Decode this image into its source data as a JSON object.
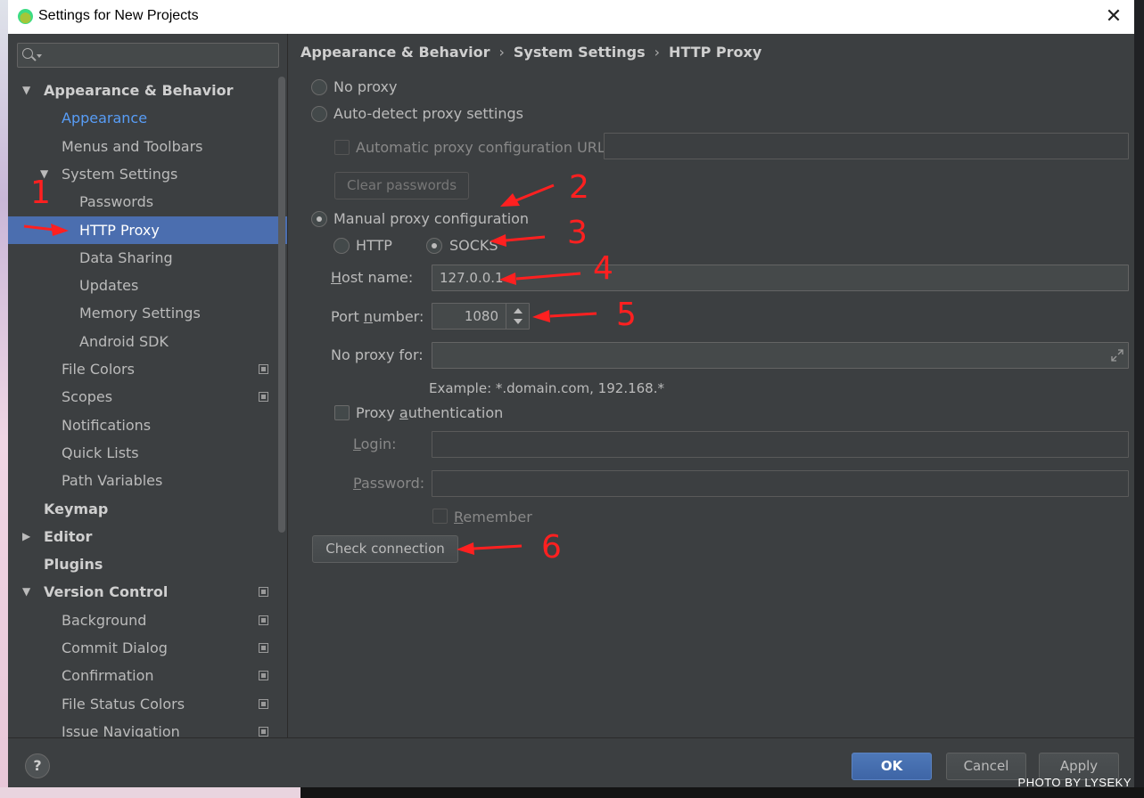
{
  "window": {
    "title": "Settings for New Projects",
    "close_glyph": "✕"
  },
  "search": {
    "placeholder": ""
  },
  "tree": [
    {
      "label": "Appearance & Behavior",
      "level": 0,
      "bold": true,
      "expanded": true
    },
    {
      "label": "Appearance",
      "level": 1,
      "link": true
    },
    {
      "label": "Menus and Toolbars",
      "level": 1
    },
    {
      "label": "System Settings",
      "level": 1,
      "expanded": true
    },
    {
      "label": "Passwords",
      "level": 2
    },
    {
      "label": "HTTP Proxy",
      "level": 2,
      "selected": true
    },
    {
      "label": "Data Sharing",
      "level": 2
    },
    {
      "label": "Updates",
      "level": 2
    },
    {
      "label": "Memory Settings",
      "level": 2
    },
    {
      "label": "Android SDK",
      "level": 2
    },
    {
      "label": "File Colors",
      "level": 1,
      "project": true
    },
    {
      "label": "Scopes",
      "level": 1,
      "project": true
    },
    {
      "label": "Notifications",
      "level": 1
    },
    {
      "label": "Quick Lists",
      "level": 1
    },
    {
      "label": "Path Variables",
      "level": 1
    },
    {
      "label": "Keymap",
      "level": 0,
      "bold": true
    },
    {
      "label": "Editor",
      "level": 0,
      "bold": true,
      "collapsed": true
    },
    {
      "label": "Plugins",
      "level": 0,
      "bold": true
    },
    {
      "label": "Version Control",
      "level": 0,
      "bold": true,
      "expanded": true,
      "project": true
    },
    {
      "label": "Background",
      "level": 1,
      "project": true
    },
    {
      "label": "Commit Dialog",
      "level": 1,
      "project": true
    },
    {
      "label": "Confirmation",
      "level": 1,
      "project": true
    },
    {
      "label": "File Status Colors",
      "level": 1,
      "project": true
    },
    {
      "label": "Issue Navigation",
      "level": 1,
      "project": true
    }
  ],
  "breadcrumb": {
    "part1": "Appearance & Behavior",
    "part2": "System Settings",
    "part3": "HTTP Proxy",
    "sep": "›"
  },
  "proxy": {
    "no_proxy": "No proxy",
    "auto_detect": "Auto-detect proxy settings",
    "auto_url_label": "Automatic proxy configuration URL:",
    "auto_url_value": "",
    "clear_passwords": "Clear passwords",
    "manual": "Manual proxy configuration",
    "http": "HTTP",
    "socks": "SOCKS",
    "host_label_u": "H",
    "host_label_rest": "ost name:",
    "host_value": "127.0.0.1",
    "port_label_a": "Port ",
    "port_label_u": "n",
    "port_label_b": "umber:",
    "port_value": "1080",
    "no_proxy_for_label": "No proxy for:",
    "no_proxy_for_value": "",
    "example": "Example: *.domain.com, 192.168.*",
    "auth_a": "Proxy ",
    "auth_u": "a",
    "auth_b": "uthentication",
    "login_u": "L",
    "login_rest": "ogin:",
    "password_u": "P",
    "password_rest": "assword:",
    "remember_u": "R",
    "remember_rest": "emember",
    "check_connection": "Check connection",
    "selected_mode": "manual",
    "selected_type": "SOCKS"
  },
  "annotations": [
    "1",
    "2",
    "3",
    "4",
    "5",
    "6"
  ],
  "footer": {
    "help": "?",
    "ok": "OK",
    "cancel": "Cancel",
    "apply": "Apply"
  },
  "watermark": "PHOTO BY LYSEKY",
  "colors": {
    "accent": "#4b6eaf",
    "link": "#589df6",
    "annotation": "#ff2020",
    "background": "#3c3f41"
  }
}
